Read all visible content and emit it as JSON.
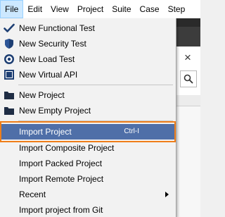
{
  "menubar": {
    "items": [
      {
        "label": "File"
      },
      {
        "label": "Edit"
      },
      {
        "label": "View"
      },
      {
        "label": "Project"
      },
      {
        "label": "Suite"
      },
      {
        "label": "Case"
      },
      {
        "label": "Step"
      }
    ]
  },
  "file_menu": {
    "new_functional_test": "New Functional Test",
    "new_security_test": "New Security Test",
    "new_load_test": "New Load Test",
    "new_virtual_api": "New Virtual API",
    "new_project": "New Project",
    "new_empty_project": "New Empty Project",
    "import_project": "Import Project",
    "import_project_shortcut": "Ctrl-I",
    "import_composite_project": "Import Composite Project",
    "import_packed_project": "Import Packed Project",
    "import_remote_project": "Import Remote Project",
    "recent": "Recent",
    "import_project_from_git": "Import project from Git"
  },
  "background": {
    "close_glyph": "×"
  },
  "colors": {
    "highlight_bg": "#4f6fa8",
    "callout_border": "#ef7e1a",
    "menubar_active": "#cce8ff"
  }
}
